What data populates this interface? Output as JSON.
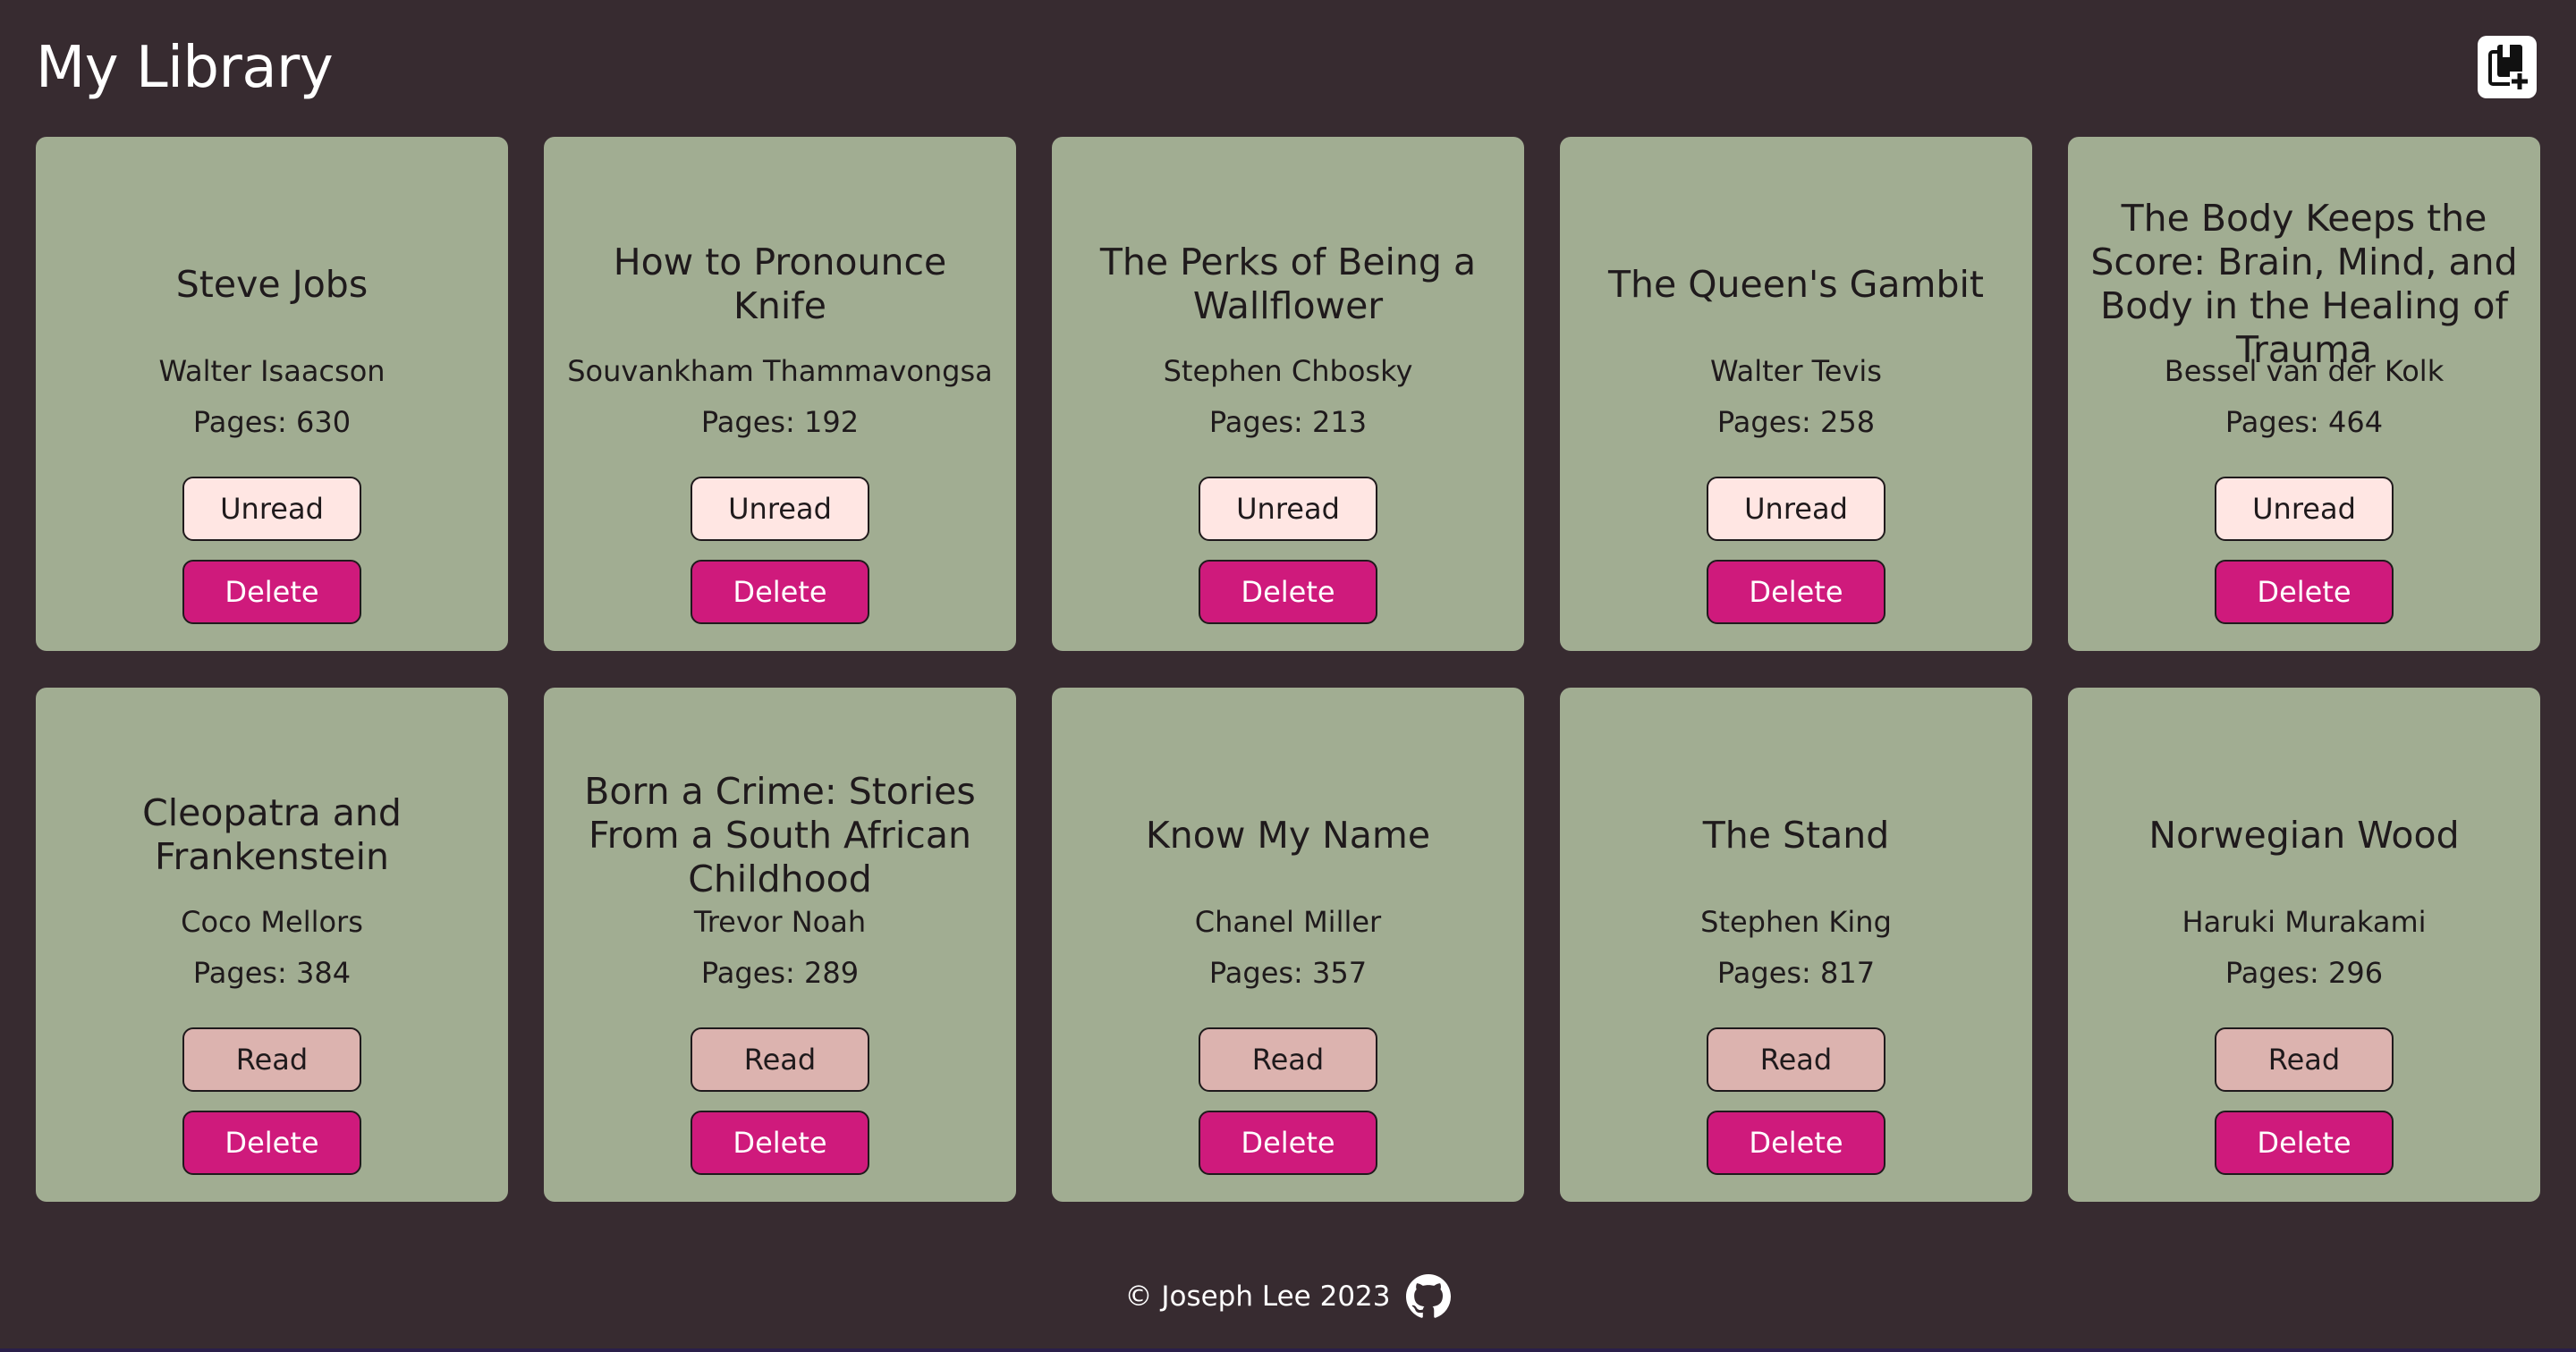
{
  "header": {
    "title": "My Library",
    "add_icon": "add-book-icon"
  },
  "labels": {
    "pages_prefix": "Pages: ",
    "delete": "Delete"
  },
  "books": [
    {
      "title": "Steve Jobs",
      "author": "Walter Isaacson",
      "pages": "630",
      "status": "Unread"
    },
    {
      "title": "How to Pronounce Knife",
      "author": "Souvankham Thammavongsa",
      "pages": "192",
      "status": "Unread"
    },
    {
      "title": "The Perks of Being a Wallflower",
      "author": "Stephen Chbosky",
      "pages": "213",
      "status": "Unread"
    },
    {
      "title": "The Queen's Gambit",
      "author": "Walter Tevis",
      "pages": "258",
      "status": "Unread"
    },
    {
      "title": "The Body Keeps the Score: Brain, Mind, and Body in the Healing of Trauma",
      "author": "Bessel van der Kolk",
      "pages": "464",
      "status": "Unread"
    },
    {
      "title": "Cleopatra and Frankenstein",
      "author": "Coco Mellors",
      "pages": "384",
      "status": "Read"
    },
    {
      "title": "Born a Crime: Stories From a South African Childhood",
      "author": "Trevor Noah",
      "pages": "289",
      "status": "Read"
    },
    {
      "title": "Know My Name",
      "author": "Chanel Miller",
      "pages": "357",
      "status": "Read"
    },
    {
      "title": "The Stand",
      "author": "Stephen King",
      "pages": "817",
      "status": "Read"
    },
    {
      "title": "Norwegian Wood",
      "author": "Haruki Murakami",
      "pages": "296",
      "status": "Read"
    }
  ],
  "footer": {
    "copyright": "© Joseph Lee 2023",
    "github_icon": "github-icon"
  },
  "colors": {
    "background": "#372b30",
    "card": "#a1ad92",
    "delete": "#cf1a7c",
    "unread": "#ffe6e3",
    "read": "#dcb3af"
  }
}
